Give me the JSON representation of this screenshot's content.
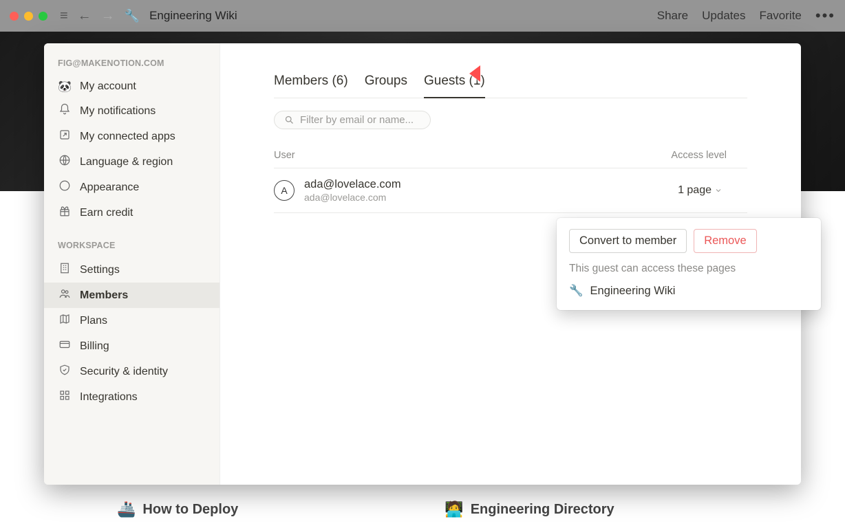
{
  "window": {
    "page_icon": "🔧",
    "page_title": "Engineering Wiki",
    "right_actions": [
      "Share",
      "Updates",
      "Favorite"
    ]
  },
  "background_pages": [
    {
      "emoji": "🚢",
      "label": "How to Deploy"
    },
    {
      "emoji": "🧑‍💻",
      "label": "Engineering Directory"
    }
  ],
  "sidebar": {
    "section_account_label": "FIG@MAKENOTION.COM",
    "account_items": [
      {
        "key": "my-account",
        "label": "My account",
        "icon": "panda"
      },
      {
        "key": "my-notifications",
        "label": "My notifications",
        "icon": "bell"
      },
      {
        "key": "my-connected-apps",
        "label": "My connected apps",
        "icon": "external"
      },
      {
        "key": "language-region",
        "label": "Language & region",
        "icon": "globe"
      },
      {
        "key": "appearance",
        "label": "Appearance",
        "icon": "moon"
      },
      {
        "key": "earn-credit",
        "label": "Earn credit",
        "icon": "gift"
      }
    ],
    "section_workspace_label": "WORKSPACE",
    "workspace_items": [
      {
        "key": "settings",
        "label": "Settings",
        "icon": "building"
      },
      {
        "key": "members",
        "label": "Members",
        "icon": "people",
        "active": true
      },
      {
        "key": "plans",
        "label": "Plans",
        "icon": "map"
      },
      {
        "key": "billing",
        "label": "Billing",
        "icon": "card"
      },
      {
        "key": "security-identity",
        "label": "Security & identity",
        "icon": "shield"
      },
      {
        "key": "integrations",
        "label": "Integrations",
        "icon": "grid"
      }
    ]
  },
  "content": {
    "tabs": {
      "members": "Members (6)",
      "groups": "Groups",
      "guests": "Guests (1)"
    },
    "active_tab": "guests",
    "filter_placeholder": "Filter by email or name...",
    "table": {
      "col_user": "User",
      "col_access": "Access level"
    },
    "rows": [
      {
        "initial": "A",
        "name": "ada@lovelace.com",
        "email": "ada@lovelace.com",
        "access": "1 page"
      }
    ]
  },
  "popover": {
    "convert_label": "Convert to member",
    "remove_label": "Remove",
    "message": "This guest can access these pages",
    "pages": [
      {
        "icon": "🔧",
        "label": "Engineering Wiki"
      }
    ]
  }
}
